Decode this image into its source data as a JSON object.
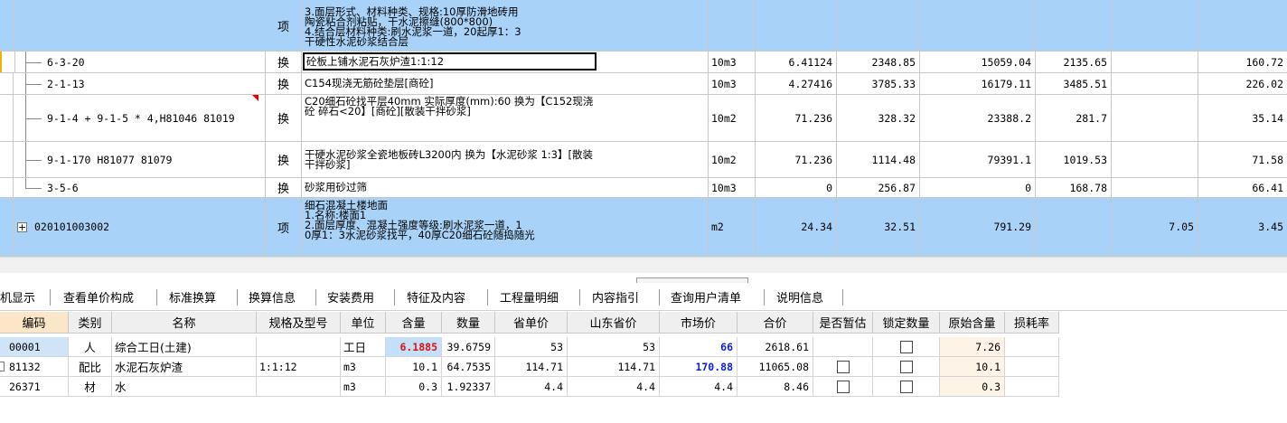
{
  "top_grid": {
    "partial_row": {
      "type_label": "项",
      "name_lines": [
        "3.面层形式、材料种类、规格:10厚防滑地砖用",
        "陶瓷粘合剂粘贴，干水泥擦缝(800*800)",
        "4.结合层材料种类:刷水泥浆一道，20起厚1：3",
        "干硬性水泥砂浆结合层"
      ]
    },
    "rows": [
      {
        "code": "6-3-20",
        "type": "换",
        "name": "砼板上铺水泥石灰炉渣1:1:12",
        "unit": "10m3",
        "qty": "6.41124",
        "price": "2348.85",
        "total": "15059.04",
        "c4": "2135.65",
        "c5": "",
        "c6": "160.72"
      },
      {
        "code": "2-1-13",
        "type": "换",
        "name": "C154现浇无筋砼垫层[商砼]",
        "unit": "10m3",
        "qty": "4.27416",
        "price": "3785.33",
        "total": "16179.11",
        "c4": "3485.51",
        "c5": "",
        "c6": "226.02"
      },
      {
        "code": "9-1-4 + 9-1-5 * 4,H81046 81019",
        "type": "换",
        "name": "C20细石砼找平层40mm  实际厚度(mm):60  换为【C152现浇砼 碎石<20】[商砼][散装干拌砂浆]",
        "unit": "10m2",
        "qty": "71.236",
        "price": "328.32",
        "total": "23388.2",
        "c4": "281.7",
        "c5": "",
        "c6": "35.14"
      },
      {
        "code": "9-1-170 H81077 81079",
        "type": "换",
        "name": "干硬水泥砂浆全瓷地板砖L3200内  换为【水泥砂浆 1:3】[散装干拌砂浆]",
        "unit": "10m2",
        "qty": "71.236",
        "price": "1114.48",
        "total": "79391.1",
        "c4": "1019.53",
        "c5": "",
        "c6": "71.58"
      },
      {
        "code": "3-5-6",
        "type": "换",
        "name": "砂浆用砂过筛",
        "unit": "10m3",
        "qty": "0",
        "price": "256.87",
        "total": "0",
        "c4": "168.78",
        "c5": "",
        "c6": "66.41"
      }
    ],
    "item_row": {
      "code": "020101003002",
      "type": "项",
      "name_lines": [
        "细石混凝土楼地面",
        "1.名称:楼面1",
        "2.面层厚度、混凝土强度等级:刷水泥浆一道，1",
        "0厚1：3水泥砂浆找平，40厚C20细石砼随捣随光"
      ],
      "unit": "m2",
      "qty": "24.34",
      "price": "32.51",
      "total": "791.29",
      "c4": "",
      "c5": "7.05",
      "c6": "3.45"
    }
  },
  "tabs": [
    "机显示",
    "查看单价构成",
    "标准换算",
    "换算信息",
    "安装费用",
    "特征及内容",
    "工程量明细",
    "内容指引",
    "查询用户清单",
    "说明信息"
  ],
  "bottom_grid": {
    "headers": [
      "编码",
      "类别",
      "名称",
      "规格及型号",
      "单位",
      "含量",
      "数量",
      "省单价",
      "山东省价",
      "市场价",
      "合价",
      "是否暂估",
      "锁定数量",
      "原始含量",
      "损耗率"
    ],
    "rows": [
      {
        "code": "00001",
        "cat": "人",
        "name": "综合工日(土建)",
        "spec": "",
        "unit": "工日",
        "content": "6.1885",
        "qty": "39.6759",
        "prov": "53",
        "sd": "53",
        "market": "66",
        "sum": "2618.61",
        "orig": "7.26",
        "loss": ""
      },
      {
        "code": "81132",
        "cat": "配比",
        "name": "水泥石灰炉渣",
        "spec": "1:1:12",
        "unit": "m3",
        "content": "10.1",
        "qty": "64.7535",
        "prov": "114.71",
        "sd": "114.71",
        "market": "170.88",
        "sum": "11065.08",
        "orig": "10.1",
        "loss": ""
      },
      {
        "code": "26371",
        "cat": "材",
        "name": "水",
        "spec": "",
        "unit": "m3",
        "content": "0.3",
        "qty": "1.92337",
        "prov": "4.4",
        "sd": "4.4",
        "market": "4.4",
        "sum": "8.46",
        "orig": "0.3",
        "loss": ""
      }
    ]
  },
  "colors": {
    "row_highlight": "#a8d2f7",
    "content_highlight": "#c4e0f8",
    "red_value": "#e01010",
    "blue_value": "#1020e0"
  }
}
